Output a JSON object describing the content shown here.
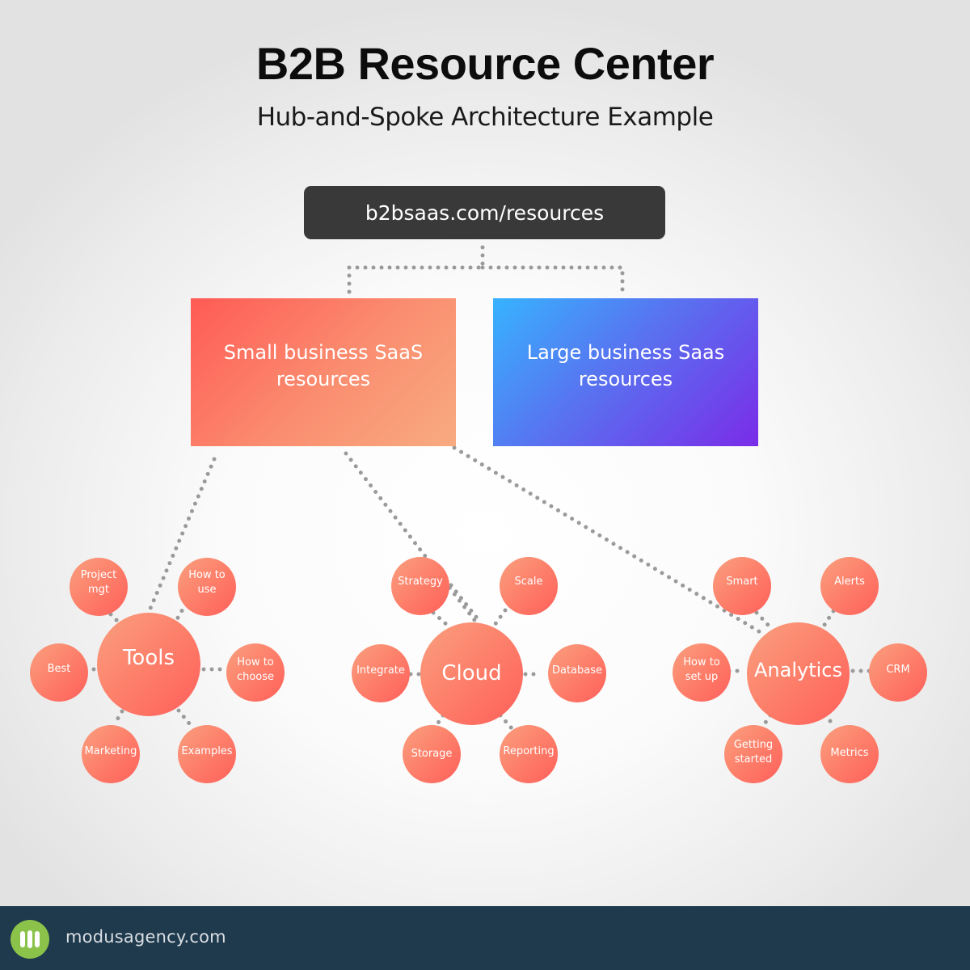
{
  "header": {
    "title": "B2B Resource Center",
    "subtitle": "Hub-and-Spoke Architecture Example"
  },
  "root": {
    "label": "b2bsaas.com/resources",
    "color": "#393939"
  },
  "segments": [
    {
      "label": "Small business SaaS resources",
      "gradient": [
        "#ff5b55",
        "#f8ab80"
      ]
    },
    {
      "label": "Large business Saas resources",
      "gradient": [
        "#37b3ff",
        "#7a2ce8"
      ]
    }
  ],
  "hubs": [
    {
      "label": "Tools",
      "spokes": [
        "Project\nmgt",
        "How to\nuse",
        "Best",
        "How to\nchoose",
        "Marketing",
        "Examples"
      ]
    },
    {
      "label": "Cloud",
      "spokes": [
        "Strategy",
        "Scale",
        "Integrate",
        "Database",
        "Storage",
        "Reporting"
      ]
    },
    {
      "label": "Analytics",
      "spokes": [
        "Smart",
        "Alerts",
        "How to\nset up",
        "CRM",
        "Getting\nstarted",
        "Metrics"
      ]
    }
  ],
  "colors": {
    "node_light": "#f9a07f",
    "node_dark": "#ff5f5a",
    "connector": "#9a9a9a",
    "footer_bg": "#1f3a4d",
    "logo": "#8bc34a"
  },
  "footer": {
    "text": "modusagency.com",
    "logo_icon": "modus-logo-icon"
  }
}
